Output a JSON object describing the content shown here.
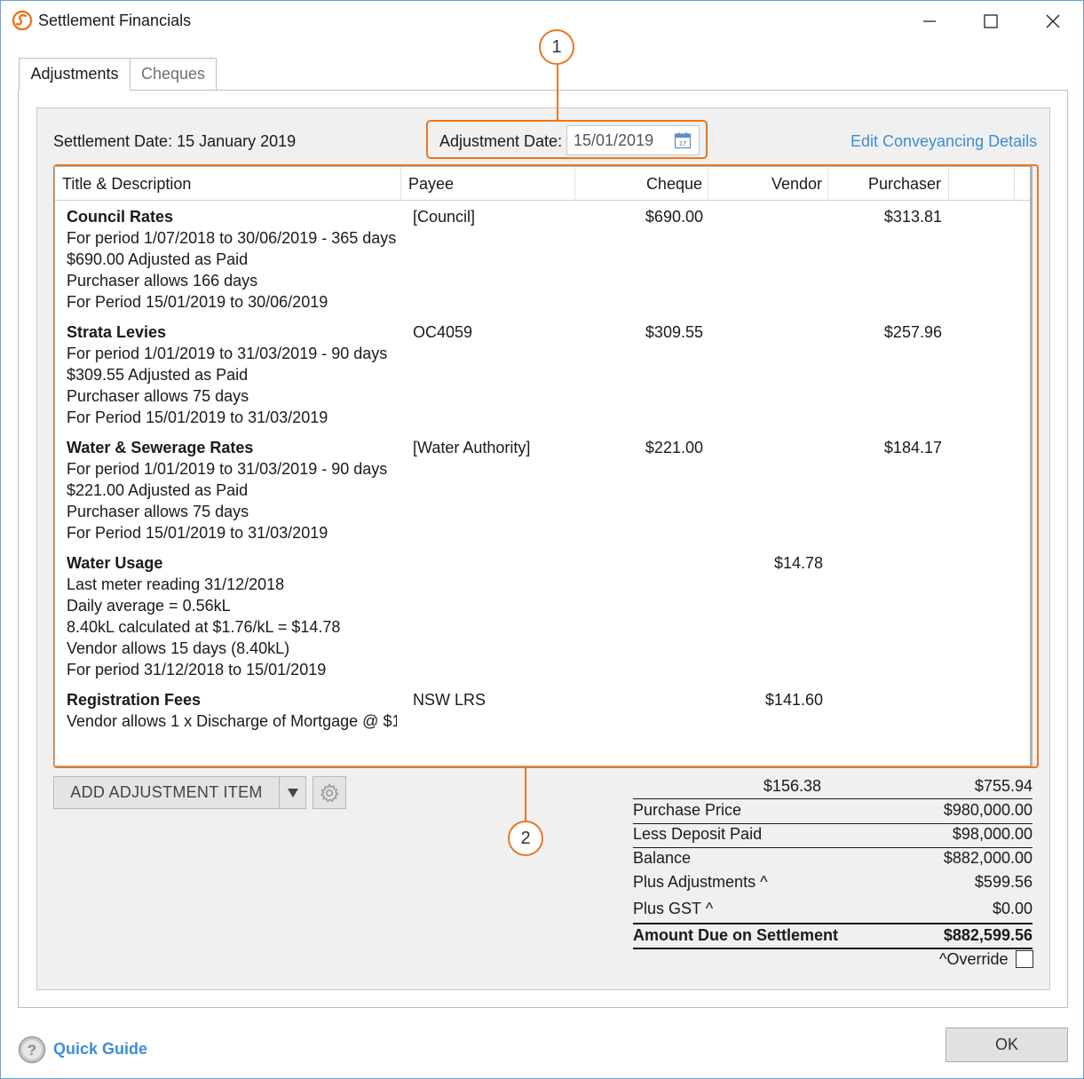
{
  "window": {
    "title": "Settlement Financials"
  },
  "tabs": [
    {
      "label": "Adjustments"
    },
    {
      "label": "Cheques"
    }
  ],
  "header": {
    "settlement_date": "Settlement Date: 15 January 2019",
    "adjustment_date_label": "Adjustment Date:",
    "adjustment_date_value": "15/01/2019",
    "edit_link": "Edit Conveyancing Details"
  },
  "callouts": [
    "1",
    "2"
  ],
  "grid": {
    "columns": [
      "Title & Description",
      "Payee",
      "Cheque",
      "Vendor",
      "Purchaser"
    ],
    "rows": [
      {
        "title": "Council Rates",
        "lines": [
          "For period 1/07/2018 to 30/06/2019 - 365 days",
          "$690.00 Adjusted as Paid",
          "Purchaser allows 166 days",
          "For Period 15/01/2019 to 30/06/2019"
        ],
        "payee": "[Council]",
        "cheque": "$690.00",
        "vendor": "",
        "purchaser": "$313.81"
      },
      {
        "title": "Strata Levies",
        "lines": [
          "For period 1/01/2019 to 31/03/2019 - 90 days",
          "$309.55 Adjusted as Paid",
          "Purchaser allows 75 days",
          "For Period 15/01/2019 to 31/03/2019"
        ],
        "payee": "OC4059",
        "cheque": "$309.55",
        "vendor": "",
        "purchaser": "$257.96"
      },
      {
        "title": "Water & Sewerage Rates",
        "lines": [
          "For period 1/01/2019 to 31/03/2019 - 90 days",
          "$221.00 Adjusted as Paid",
          "Purchaser allows 75 days",
          "For Period 15/01/2019 to 31/03/2019"
        ],
        "payee": "[Water Authority]",
        "cheque": "$221.00",
        "vendor": "",
        "purchaser": "$184.17"
      },
      {
        "title": "Water Usage",
        "lines": [
          "Last meter reading 31/12/2018",
          "Daily average = 0.56kL",
          "8.40kL calculated at $1.76/kL = $14.78",
          "Vendor allows 15 days (8.40kL)",
          "For period 31/12/2018 to 15/01/2019"
        ],
        "payee": "",
        "cheque": "",
        "vendor": "$14.78",
        "purchaser": ""
      },
      {
        "title": "Registration Fees",
        "lines": [
          "Vendor allows 1 x Discharge of Mortgage @ $1"
        ],
        "payee": "NSW LRS",
        "cheque": "",
        "vendor": "$141.60",
        "purchaser": ""
      }
    ]
  },
  "actions": {
    "add_item_label": "ADD ADJUSTMENT ITEM"
  },
  "totals": {
    "vendor_total": "$156.38",
    "purchaser_total": "$755.94",
    "purchase_price_label": "Purchase Price",
    "purchase_price": "$980,000.00",
    "deposit_label": "Less Deposit Paid",
    "deposit": "$98,000.00",
    "balance_label": "Balance",
    "balance": "$882,000.00",
    "plus_adj_label": "Plus Adjustments ^",
    "plus_adj": "$599.56",
    "plus_gst_label": "Plus GST ^",
    "plus_gst": "$0.00",
    "amount_due_label": "Amount Due on Settlement",
    "amount_due": "$882,599.56",
    "override_label": "^Override"
  },
  "footer": {
    "quick_guide": "Quick Guide",
    "ok_label": "OK"
  },
  "colors": {
    "accent": "#e87722",
    "link": "#3c8dd8"
  }
}
